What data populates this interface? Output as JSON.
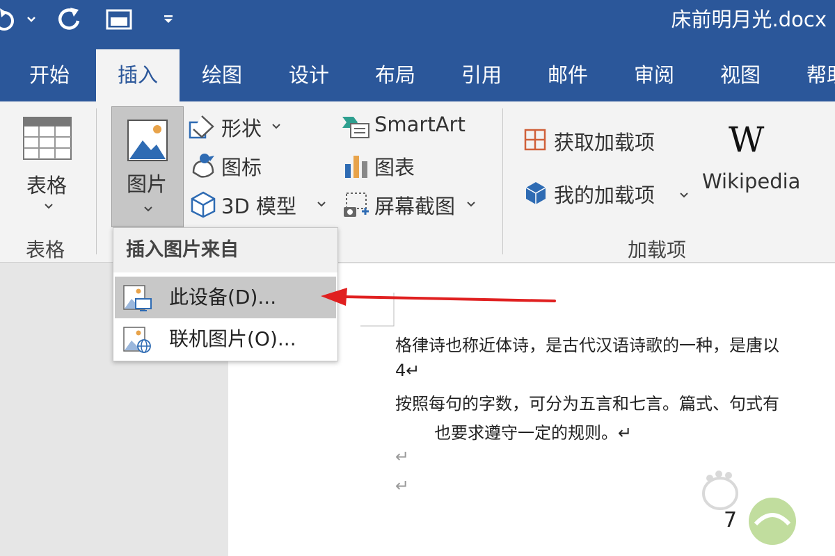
{
  "window": {
    "title": "床前明月光.docx"
  },
  "quick_access": {
    "undo_icon": "undo-icon",
    "redo_icon": "redo-icon",
    "layout_icon": "window-layout-icon",
    "customize_icon": "customize-quick-access-icon"
  },
  "tabs": [
    {
      "label": "开始"
    },
    {
      "label": "插入",
      "active": true
    },
    {
      "label": "绘图"
    },
    {
      "label": "设计"
    },
    {
      "label": "布局"
    },
    {
      "label": "引用"
    },
    {
      "label": "邮件"
    },
    {
      "label": "审阅"
    },
    {
      "label": "视图"
    },
    {
      "label": "帮助"
    }
  ],
  "ribbon": {
    "table": {
      "button_label": "表格",
      "group_label": "表格"
    },
    "pictures": {
      "button_label": "图片"
    },
    "illustrations": {
      "shapes": "形状",
      "icons": "图标",
      "model3d": "3D 模型",
      "smartart": "SmartArt",
      "chart": "图表",
      "screenshot": "屏幕截图"
    },
    "addins": {
      "get_addins": "获取加载项",
      "my_addins": "我的加载项",
      "wikipedia": "Wikipedia",
      "wikipedia_logo": "W",
      "group_label": "加载项"
    }
  },
  "dropdown": {
    "header": "插入图片来自",
    "items": [
      {
        "label": "此设备(D)...",
        "icon": "picture-device-icon"
      },
      {
        "label": "联机图片(O)...",
        "icon": "picture-online-icon"
      }
    ]
  },
  "document": {
    "lines": [
      "格律诗也称近体诗，是古代汉语诗歌的一种，是唐以",
      "4↵",
      "按照每句的字数，可分为五言和七言。篇式、句式有",
      "也要求遵守一定的规则。↵"
    ],
    "para_mark": "↵",
    "partial_text": "7"
  },
  "colors": {
    "ribbon_blue": "#2b579a",
    "arrow_red": "#e02020"
  }
}
